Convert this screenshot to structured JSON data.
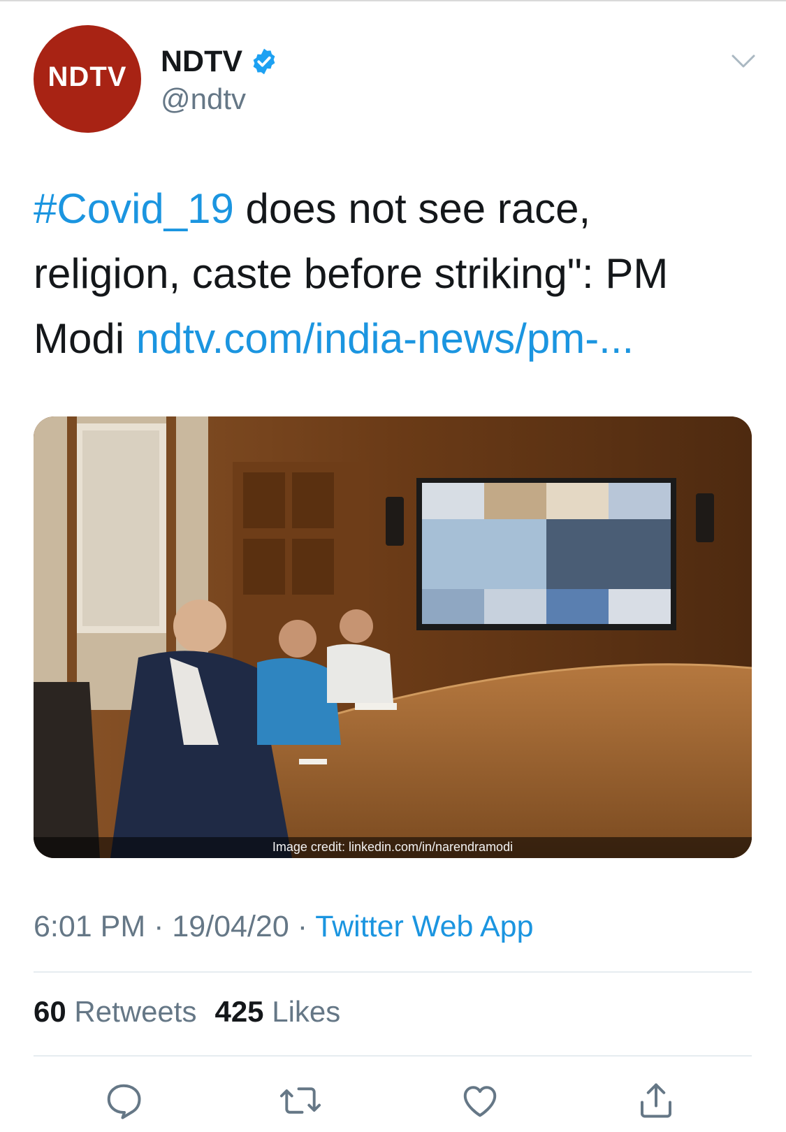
{
  "author": {
    "display_name": "NDTV",
    "handle": "@ndtv",
    "avatar_text": "NDTV",
    "verified": true,
    "avatar_color": "#a82314",
    "verified_color": "#1da1f2"
  },
  "tweet": {
    "hashtag": "#Covid_19",
    "text_1": " does not see race, religion, caste before striking\": PM Modi ",
    "link_text": "ndtv.com/india-news/pm-..."
  },
  "media": {
    "credit": "Image credit: linkedin.com/in/narendramodi"
  },
  "meta": {
    "time": "6:01 PM",
    "separator": " · ",
    "date": "19/04/20",
    "separator2": " · ",
    "source": "Twitter Web App"
  },
  "stats": {
    "retweets_count": "60",
    "retweets_label": " Retweets",
    "likes_count": "425",
    "likes_label": " Likes"
  },
  "icons": {
    "reply": "reply-icon",
    "retweet": "retweet-icon",
    "like": "heart-icon",
    "share": "share-icon",
    "menu": "chevron-down-icon",
    "verified": "verified-badge-icon"
  },
  "colors": {
    "link": "#1b95e0",
    "secondary_text": "#657786",
    "primary_text": "#14171a"
  }
}
